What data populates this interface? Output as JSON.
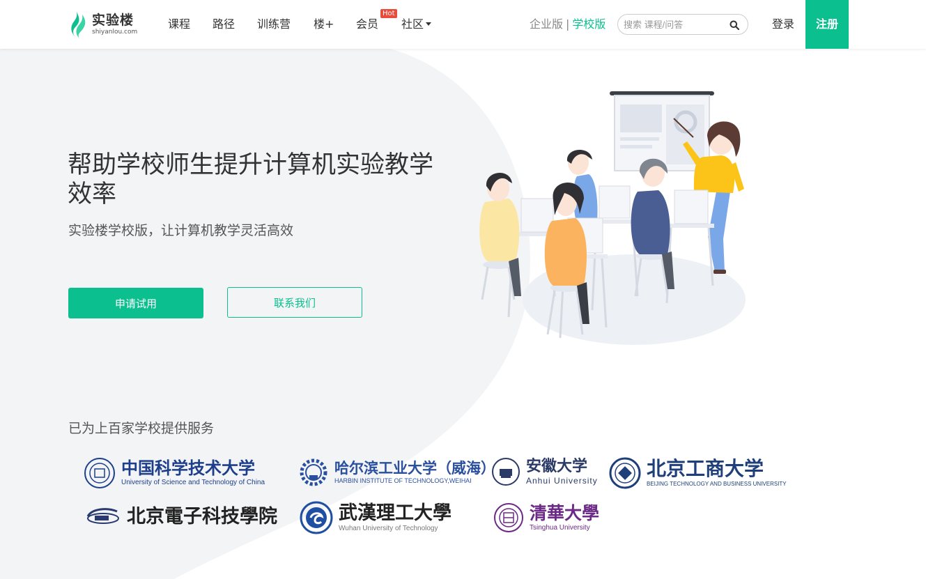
{
  "header": {
    "logo": {
      "name": "实验楼",
      "domain": "shiyanlou.com"
    },
    "nav": [
      {
        "label": "课程"
      },
      {
        "label": "路径"
      },
      {
        "label": "训练营"
      },
      {
        "label": "楼+"
      },
      {
        "label": "会员",
        "badge": "Hot"
      },
      {
        "label": "社区",
        "has_dropdown": true
      }
    ],
    "edition": {
      "enterprise": "企业版",
      "separator": "|",
      "school": "学校版"
    },
    "search": {
      "placeholder": "搜索 课程/问答",
      "icon": "search-icon"
    },
    "login": "登录",
    "register": "注册"
  },
  "hero": {
    "headline": "帮助学校师生提升计算机实验教学效率",
    "subline": "实验楼学校版，让计算机教学灵活高效",
    "primary_button": "申请试用",
    "secondary_button": "联系我们"
  },
  "partners": {
    "title": "已为上百家学校提供服务",
    "schools": [
      {
        "cn": "中国科学技术大学",
        "en": "University of Science and Technology of China"
      },
      {
        "cn": "哈尔滨工业大学（威海）",
        "en": "HARBIN INSTITUTE OF TECHNOLOGY,WEIHAI"
      },
      {
        "cn": "安徽大学",
        "en": "Anhui University"
      },
      {
        "cn": "北京工商大学",
        "en": "BEIJING TECHNOLOGY AND BUSINESS UNIVERSITY"
      },
      {
        "cn": "北京電子科技學院",
        "en": ""
      },
      {
        "cn": "武漢理工大學",
        "en": "Wuhan University of Technology"
      },
      {
        "cn": "清華大學",
        "en": "Tsinghua University"
      }
    ]
  },
  "colors": {
    "brand": "#0bbf8f",
    "hot": "#e74c3c",
    "text": "#333333",
    "blob": "#f2f4f6"
  }
}
